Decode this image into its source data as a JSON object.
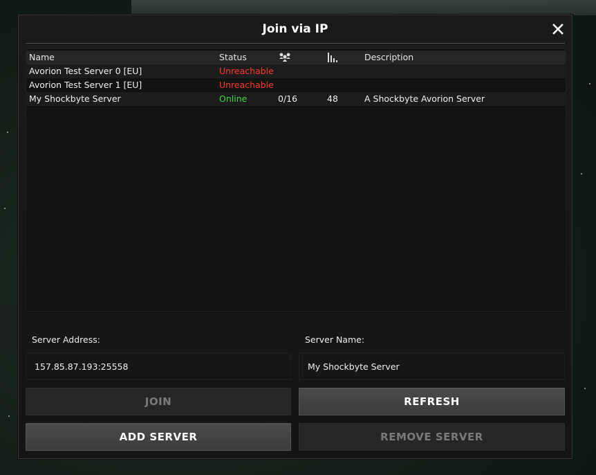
{
  "dialog": {
    "title": "Join via IP"
  },
  "server_list": {
    "columns": {
      "name": "Name",
      "status": "Status",
      "players_icon": "players-icon",
      "ping_icon": "ping-signal-icon",
      "description": "Description"
    },
    "rows": [
      {
        "name": "Avorion Test Server 0 [EU]",
        "status": "Unreachable",
        "status_color": "#ff3a2e",
        "players": "",
        "ping": "",
        "description": ""
      },
      {
        "name": "Avorion Test Server 1 [EU]",
        "status": "Unreachable",
        "status_color": "#ff3a2e",
        "players": "",
        "ping": "",
        "description": ""
      },
      {
        "name": "My Shockbyte Server",
        "status": "Online",
        "status_color": "#3ed93e",
        "players": "0/16",
        "ping": "48",
        "description": "A Shockbyte Avorion Server"
      }
    ]
  },
  "form": {
    "address_label": "Server Address:",
    "address_value": "157.85.87.193:25558",
    "name_label": "Server Name:",
    "name_value": "My Shockbyte Server"
  },
  "buttons": {
    "join": "JOIN",
    "refresh": "REFRESH",
    "add_server": "ADD SERVER",
    "remove_server": "REMOVE SERVER"
  },
  "icons": {
    "close": "close-icon"
  }
}
